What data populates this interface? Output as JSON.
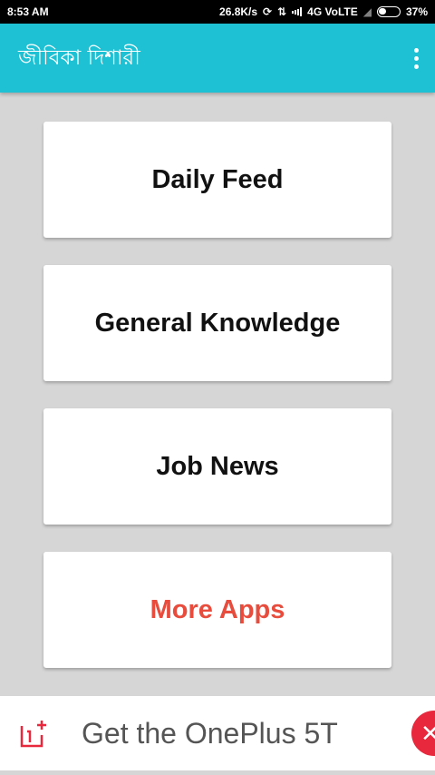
{
  "status_bar": {
    "time": "8:53 AM",
    "speed": "26.8K/s",
    "network": "4G VoLTE",
    "battery": "37%"
  },
  "app_bar": {
    "title": "জীবিকা দিশারী",
    "menu_icon": "overflow-menu-icon",
    "background_color": "#1ec1d3"
  },
  "menu": {
    "items": [
      {
        "label": "Daily Feed"
      },
      {
        "label": "General Knowledge"
      },
      {
        "label": "Job News"
      },
      {
        "label": "More Apps",
        "color": "#e74c3c"
      }
    ]
  },
  "ad": {
    "text": "Get the OnePlus 5T",
    "logo_icon": "oneplus-logo-icon",
    "close_icon": "close-icon"
  }
}
